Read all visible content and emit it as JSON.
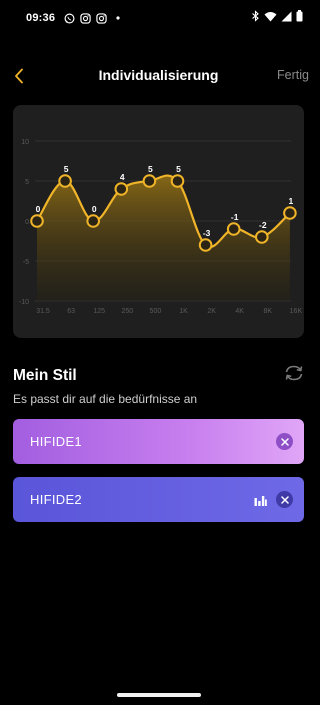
{
  "status_bar": {
    "time": "09:36",
    "notification_icons": [
      "whatsapp-icon",
      "instagram-icon",
      "instagram-icon",
      "dot-icon"
    ],
    "system_icons": [
      "bluetooth-icon",
      "wifi-icon",
      "signal-icon",
      "battery-icon"
    ]
  },
  "header": {
    "back_icon": "chevron-left-icon",
    "title": "Individualisierung",
    "done_label": "Fertig"
  },
  "colors": {
    "accent": "#f0b429",
    "card_bg": "#1f1f1f",
    "preset_1": "#b36ce8",
    "preset_2": "#625de0"
  },
  "chart_data": {
    "type": "line",
    "categories": [
      "31.5",
      "63",
      "125",
      "250",
      "500",
      "1K",
      "2K",
      "4K",
      "8K",
      "16K"
    ],
    "values": [
      0,
      5,
      0,
      4,
      5,
      5,
      -3,
      -1,
      -2,
      1
    ],
    "data_labels": [
      "0",
      "5",
      "0",
      "4",
      "5",
      "5",
      "-3",
      "-1",
      "-2",
      "1"
    ],
    "yticks": [
      "10",
      "5",
      "0",
      "-5",
      "-10"
    ],
    "ylim": [
      -10,
      10
    ],
    "grid": true,
    "legend": "none",
    "fill": "area"
  },
  "my_style": {
    "title": "Mein Stil",
    "subtitle": "Es passt dir auf die bedürfnisse an",
    "refresh_icon": "refresh-icon"
  },
  "presets": [
    {
      "label": "HIFIDE1",
      "active": false
    },
    {
      "label": "HIFIDE2",
      "active": true
    }
  ]
}
